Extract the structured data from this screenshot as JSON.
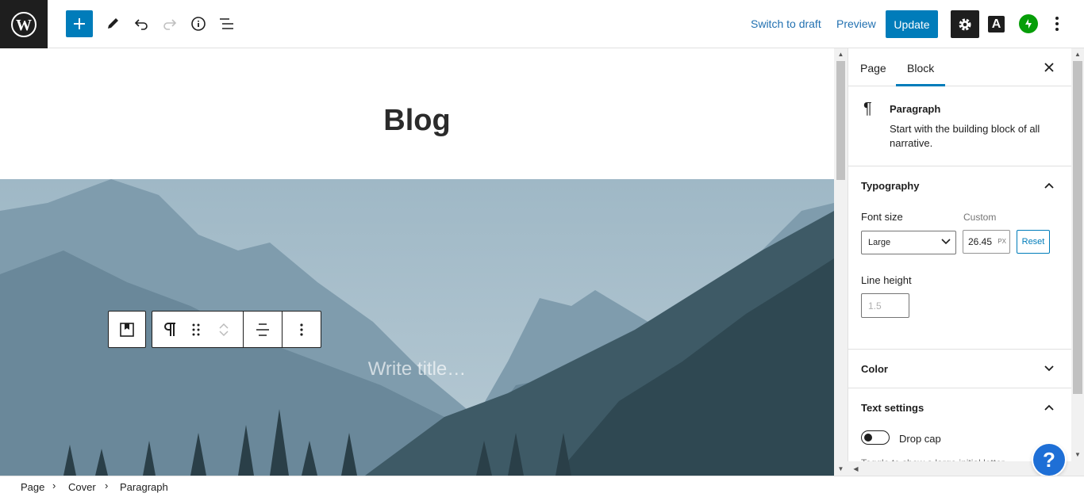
{
  "topbar": {
    "switch_to_draft": "Switch to draft",
    "preview": "Preview",
    "update": "Update",
    "a_label": "A",
    "colors": {
      "accent": "#007cba",
      "dark": "#1e1e1e",
      "jetpack": "#069e08"
    }
  },
  "editor": {
    "page_title": "Blog",
    "cover_placeholder": "Write title…"
  },
  "sidebar": {
    "tabs": [
      {
        "label": "Page"
      },
      {
        "label": "Block",
        "active": true
      }
    ],
    "block": {
      "name": "Paragraph",
      "description": "Start with the building block of all narrative."
    },
    "typography": {
      "title": "Typography",
      "font_size_label": "Font size",
      "custom_label": "Custom",
      "font_size_value": "Large",
      "custom_value": "26.45",
      "unit": "PX",
      "reset": "Reset",
      "line_height_label": "Line height",
      "line_height_placeholder": "1.5"
    },
    "color": {
      "title": "Color"
    },
    "text_settings": {
      "title": "Text settings",
      "drop_cap_label": "Drop cap",
      "help": "Toggle to show a large initial letter."
    }
  },
  "help_button": "?",
  "breadcrumb": [
    "Page",
    "Cover",
    "Paragraph"
  ]
}
